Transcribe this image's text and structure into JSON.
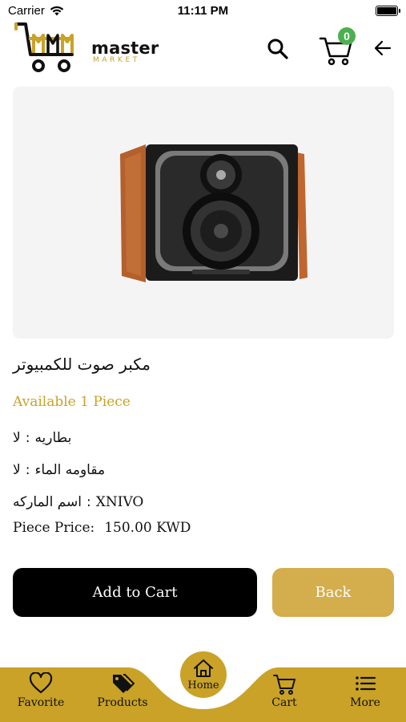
{
  "status_bar": {
    "carrier": "Carrier",
    "time": "11:11 PM"
  },
  "header": {
    "logo": {
      "word": "master",
      "sub": "MARKET"
    },
    "cart_count": "0",
    "icons": [
      "search-icon",
      "cart-icon",
      "back-arrow-icon"
    ]
  },
  "product": {
    "name": "مكبر صوت للكمبيوتر",
    "availability": "Available 1 Piece",
    "specs": [
      {
        "label": "بطاريه",
        "value": "لا"
      },
      {
        "label": "مقاومه الماء",
        "value": "لا"
      },
      {
        "label": "اسم الماركه",
        "value": "XNIVO"
      }
    ],
    "price_label": "Piece Price:",
    "price_value": "150.00 KWD"
  },
  "buttons": {
    "add_to_cart": "Add to Cart",
    "back": "Back"
  },
  "bottom_nav": {
    "favorite": "Favorite",
    "products": "Products",
    "home": "Home",
    "cart": "Cart",
    "more": "More"
  },
  "colors": {
    "accent_gold": "#c9a227",
    "button_gold": "#d4ad4c",
    "badge_green": "#4caf50",
    "primary_black": "#000000"
  }
}
